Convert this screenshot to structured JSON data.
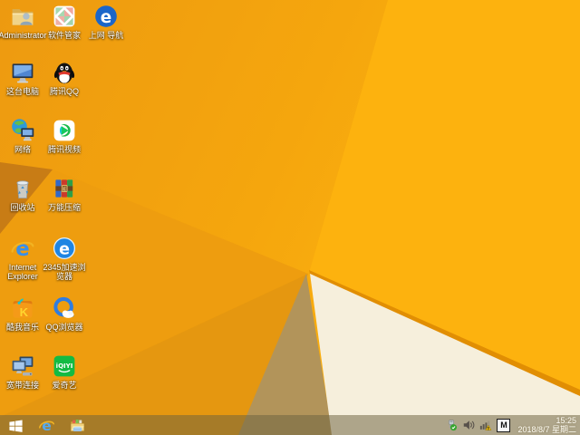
{
  "wallpaper": {
    "base_gradient": [
      "#ed9a10",
      "#f5a60d",
      "#fdb30f"
    ],
    "bright_face": "#fdb20e",
    "left_fan": "#ee9d0f",
    "dark_fold": "#c87c15",
    "lower_fan": "#e59710",
    "shadow_face": "#b2945a",
    "white_face": "#f6efdc",
    "fold_edge": "#e18e03"
  },
  "desktop": {
    "icons": [
      {
        "name": "administrator",
        "label": "Administrator",
        "type": "folder-user",
        "col": 0,
        "row": 0
      },
      {
        "name": "this-pc",
        "label": "这台电脑",
        "type": "this-pc",
        "col": 0,
        "row": 1
      },
      {
        "name": "network",
        "label": "网络",
        "type": "network-globe",
        "col": 0,
        "row": 2
      },
      {
        "name": "recycle-bin",
        "label": "回收站",
        "type": "recycle-bin",
        "col": 0,
        "row": 3
      },
      {
        "name": "internet-explorer",
        "label": "Internet Explorer",
        "type": "ie",
        "col": 0,
        "row": 4
      },
      {
        "name": "kuwo-music",
        "label": "酷我音乐",
        "type": "kuwo",
        "col": 0,
        "row": 5
      },
      {
        "name": "broadband-connection",
        "label": "宽带连接",
        "type": "broadband",
        "col": 0,
        "row": 6
      },
      {
        "name": "software-manager",
        "label": "软件管家",
        "type": "software-manager",
        "col": 1,
        "row": 0
      },
      {
        "name": "tencent-qq",
        "label": "腾讯QQ",
        "type": "qq",
        "col": 1,
        "row": 1
      },
      {
        "name": "tencent-video",
        "label": "腾讯视频",
        "type": "tencent-video",
        "col": 1,
        "row": 2
      },
      {
        "name": "universal-archiver",
        "label": "万能压缩",
        "type": "archive",
        "col": 1,
        "row": 3
      },
      {
        "name": "2345-browser",
        "label": "2345加速浏览器",
        "type": "e-blue",
        "col": 1,
        "row": 4
      },
      {
        "name": "qq-browser",
        "label": "QQ浏览器",
        "type": "qq-browser",
        "col": 1,
        "row": 5
      },
      {
        "name": "iqiyi",
        "label": "爱奇艺",
        "type": "iqiyi",
        "col": 1,
        "row": 6
      },
      {
        "name": "internet-navigation",
        "label": "上网 导航",
        "type": "e-navy",
        "col": 2,
        "row": 0
      }
    ]
  },
  "taskbar": {
    "tint": "rgba(108,98,64,0.52)",
    "buttons": [
      {
        "name": "start-button",
        "type": "win-logo"
      },
      {
        "name": "internet-explorer-task",
        "type": "ie-small"
      },
      {
        "name": "file-explorer-task",
        "type": "explorer"
      }
    ],
    "tray": {
      "status_icons": [
        {
          "name": "usb-safely-remove",
          "type": "usb"
        },
        {
          "name": "volume",
          "type": "volume"
        },
        {
          "name": "network-warning",
          "type": "wifi-warn"
        }
      ],
      "ime": "M",
      "time": "15:25",
      "date": "2018/8/7 星期二"
    }
  }
}
